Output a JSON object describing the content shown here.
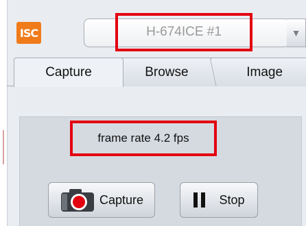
{
  "app": {
    "logo_text": "ISC"
  },
  "device": {
    "selected": "H-674ICE #1",
    "dropdown_glyph": "▼"
  },
  "tabs": [
    {
      "label": "Capture",
      "active": true
    },
    {
      "label": "Browse",
      "active": false
    },
    {
      "label": "Image",
      "active": false
    }
  ],
  "status": {
    "frame_rate_text": "frame rate 4.2 fps"
  },
  "buttons": {
    "capture_label": "Capture",
    "stop_label": "Stop"
  },
  "icons": {
    "capture": "camera-record-icon",
    "stop": "pause-icon"
  },
  "colors": {
    "accent_orange": "#f07b1a",
    "highlight_red": "#e3000f"
  }
}
